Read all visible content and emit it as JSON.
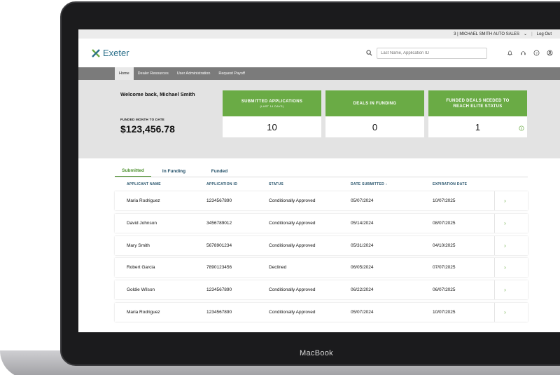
{
  "device": {
    "brand": "MacBook"
  },
  "topbar": {
    "account": "3 | MICHAEL SMITH  AUTO SALES",
    "logout": "Log Out"
  },
  "header": {
    "logo_text": "Exeter",
    "search_placeholder": "Last Name, Application ID"
  },
  "nav": {
    "items": [
      "Home",
      "Dealer Resources",
      "User Administration",
      "Request Payoff"
    ]
  },
  "summary": {
    "welcome": "Welcome back, Michael Smith",
    "funded_label": "FUNDED MONTH TO DATE",
    "funded_value": "$123,456.78",
    "cards": [
      {
        "title": "SUBMITTED APPLICATIONS",
        "subtitle": "(LAST 14 DAYS)",
        "value": "10"
      },
      {
        "title": "DEALS IN FUNDING",
        "subtitle": "",
        "value": "0"
      },
      {
        "title": "FUNDED DEALS NEEDED TO REACH ELITE STATUS",
        "subtitle": "",
        "value": "1"
      }
    ]
  },
  "tabs": [
    "Submitted",
    "In Funding",
    "Funded"
  ],
  "table": {
    "columns": [
      "APPLICANT NAME",
      "APPLICATION ID",
      "STATUS",
      "DATE SUBMITTED",
      "EXPIRATION DATE"
    ],
    "rows": [
      {
        "name": "Maria Rodriguez",
        "id": "1234567890",
        "status": "Conditionally Approved",
        "submitted": "05/07/2024",
        "expires": "10/07/2025"
      },
      {
        "name": "David Johnson",
        "id": "3456789012",
        "status": "Conditionally Approved",
        "submitted": "05/14/2024",
        "expires": "08/07/2025"
      },
      {
        "name": "Mary Smith",
        "id": "5678901234",
        "status": "Conditionally Approved",
        "submitted": "05/31/2024",
        "expires": "04/10/2025"
      },
      {
        "name": "Robert Garcia",
        "id": "7890123456",
        "status": "Declined",
        "submitted": "06/05/2024",
        "expires": "07/07/2025"
      },
      {
        "name": "Goldie Wilson",
        "id": "1234567890",
        "status": "Conditionally Approved",
        "submitted": "06/22/2024",
        "expires": "06/07/2025"
      },
      {
        "name": "Maria Rodriguez",
        "id": "1234567890",
        "status": "Conditionally Approved",
        "submitted": "05/07/2024",
        "expires": "10/07/2025"
      }
    ]
  },
  "colors": {
    "accent_green": "#6aab45",
    "nav_gray": "#7b7b7b",
    "header_teal": "#1f4d66"
  }
}
